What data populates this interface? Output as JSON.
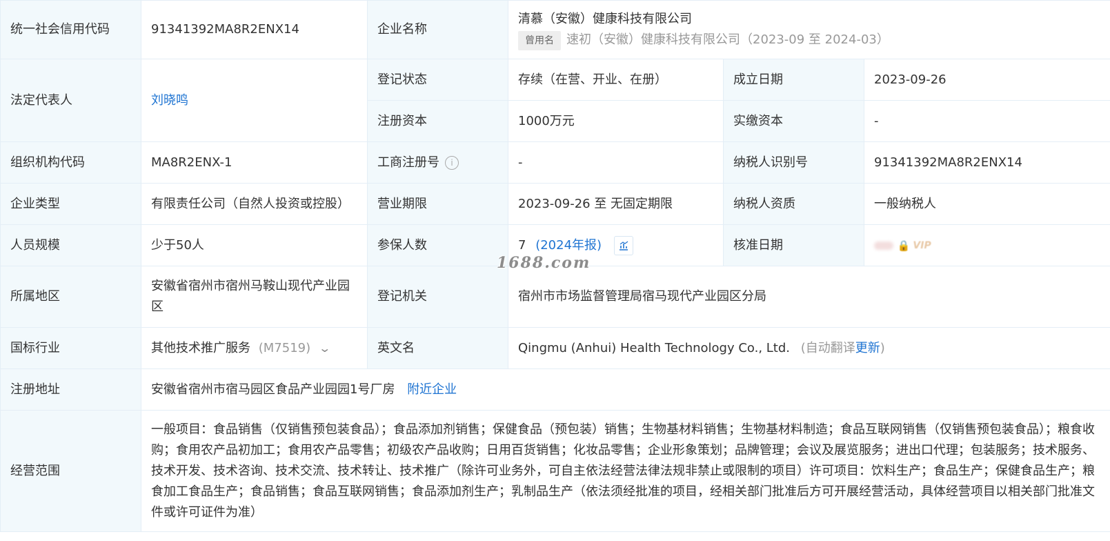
{
  "row1": {
    "credit_code_label": "统一社会信用代码",
    "credit_code": "91341392MA8R2ENX14",
    "company_name_label": "企业名称",
    "company_name": "清慕（安徽）健康科技有限公司",
    "former_name_badge": "曾用名",
    "former_name": "速初（安徽）健康科技有限公司（2023-09 至 2024-03）"
  },
  "legal_rep": {
    "label": "法定代表人",
    "value": "刘晓鸣"
  },
  "reg_status": {
    "label": "登记状态",
    "value": "存续（在营、开业、在册）"
  },
  "founded": {
    "label": "成立日期",
    "value": "2023-09-26"
  },
  "reg_capital": {
    "label": "注册资本",
    "value": "1000万元"
  },
  "paid_capital": {
    "label": "实缴资本",
    "value": "-"
  },
  "org_code": {
    "label": "组织机构代码",
    "value": "MA8R2ENX-1"
  },
  "biz_reg_no": {
    "label": "工商注册号",
    "value": "-"
  },
  "taxpayer_id": {
    "label": "纳税人识别号",
    "value": "91341392MA8R2ENX14"
  },
  "company_type": {
    "label": "企业类型",
    "value": "有限责任公司（自然人投资或控股）"
  },
  "biz_term": {
    "label": "营业期限",
    "value": "2023-09-26 至 无固定期限"
  },
  "taxpayer_qual": {
    "label": "纳税人资质",
    "value": "一般纳税人"
  },
  "staff_size": {
    "label": "人员规模",
    "value": "少于50人"
  },
  "insured": {
    "label": "参保人数",
    "value": "7",
    "report": "(2024年报)"
  },
  "approve_date": {
    "label": "核准日期",
    "vip": "VIP"
  },
  "region": {
    "label": "所属地区",
    "value": "安徽省宿州市宿州马鞍山现代产业园区"
  },
  "reg_authority": {
    "label": "登记机关",
    "value": "宿州市市场监督管理局宿马现代产业园区分局"
  },
  "industry": {
    "label": "国标行业",
    "value": "其他技术推广服务",
    "code": "(M7519)"
  },
  "english_name": {
    "label": "英文名",
    "value": "Qingmu (Anhui) Health Technology Co., Ltd.",
    "auto_prefix": "(自动翻译",
    "update": "更新",
    "auto_suffix": ")"
  },
  "reg_address": {
    "label": "注册地址",
    "value": "安徽省宿州市宿马园区食品产业园园1号厂房",
    "nearby": "附近企业"
  },
  "scope": {
    "label": "经营范围",
    "value": "一般项目：食品销售（仅销售预包装食品）；食品添加剂销售；保健食品（预包装）销售；生物基材料销售；生物基材料制造；食品互联网销售（仅销售预包装食品）；粮食收购；食用农产品初加工；食用农产品零售；初级农产品收购；日用百货销售；化妆品零售；企业形象策划；品牌管理；会议及展览服务；进出口代理；包装服务；技术服务、技术开发、技术咨询、技术交流、技术转让、技术推广（除许可业务外，可自主依法经营法律法规非禁止或限制的项目）许可项目：饮料生产；食品生产；保健食品生产；粮食加工食品生产；食品销售；食品互联网销售；食品添加剂生产；乳制品生产（依法须经批准的项目，经相关部门批准后方可开展经营活动，具体经营项目以相关部门批准文件或许可证件为准）"
  },
  "watermark": "1688.com"
}
